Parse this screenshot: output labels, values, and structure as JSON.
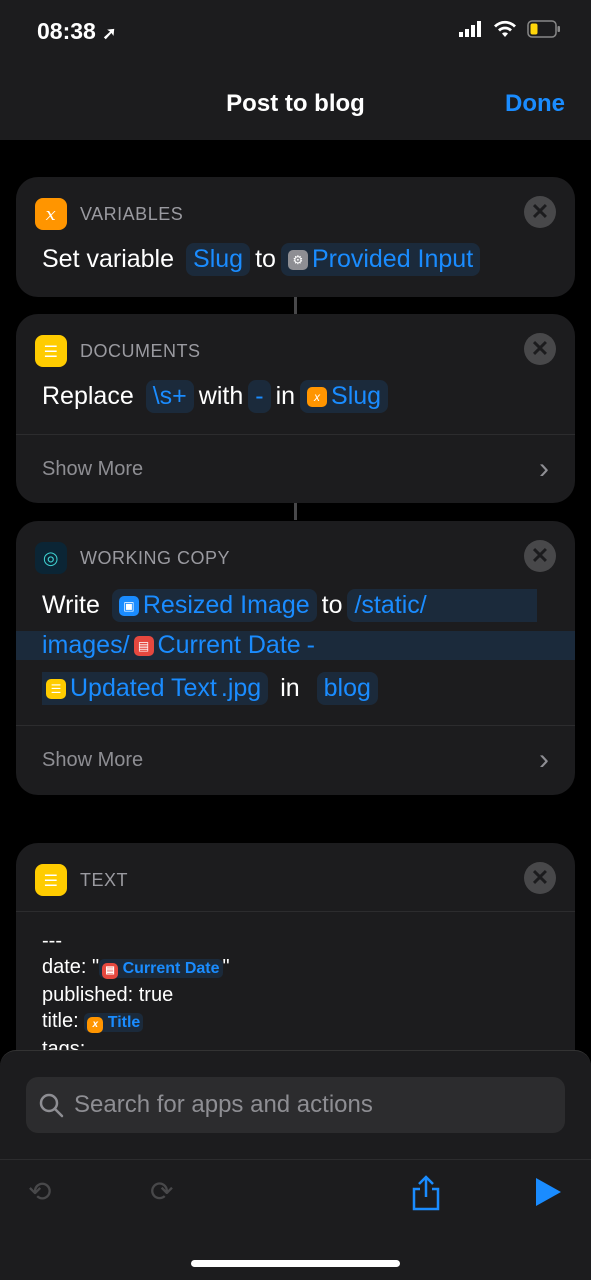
{
  "status": {
    "time": "08:38",
    "location_icon": "location-arrow-icon",
    "battery_level": 0.25
  },
  "nav": {
    "title": "Post to blog",
    "done": "Done"
  },
  "actions": [
    {
      "category": "VARIABLES",
      "icon": "variable-icon",
      "color": "#ff9500",
      "parts": {
        "set": "Set variable",
        "var": "Slug",
        "to": "to",
        "input": "Provided Input"
      }
    },
    {
      "category": "DOCUMENTS",
      "icon": "text-icon",
      "color": "#ffcc00",
      "parts": {
        "replace": "Replace",
        "pattern": "\\s+",
        "with": "with",
        "repl": "-",
        "in": "in",
        "var": "Slug"
      },
      "show_more": "Show More"
    },
    {
      "category": "WORKING COPY",
      "icon": "fingerprint-icon",
      "color": "#0b2535",
      "parts": {
        "write": "Write",
        "image": "Resized Image",
        "to": "to",
        "path1": "/static/",
        "path2": "images/",
        "date": "Current Date",
        "dash": "-",
        "text": "Updated Text",
        "ext": ".jpg",
        "in": "in",
        "repo": "blog"
      },
      "show_more": "Show More"
    },
    {
      "category": "TEXT",
      "icon": "text-icon",
      "color": "#ffcc00",
      "lines": {
        "l1": "---",
        "l2a": "date: \"",
        "l2tok": "Current Date",
        "l2b": "\"",
        "l3": "published: true",
        "l4a": "title: ",
        "l4tok": "Title",
        "l5": "tags:"
      }
    }
  ],
  "search": {
    "placeholder": "Search for apps and actions"
  },
  "toolbar": {
    "undo": "undo-icon",
    "redo": "redo-icon",
    "share": "share-icon",
    "run": "play-icon"
  },
  "colors": {
    "accent": "#1a8cff",
    "background": "#000000",
    "card": "#1c1c1e"
  }
}
